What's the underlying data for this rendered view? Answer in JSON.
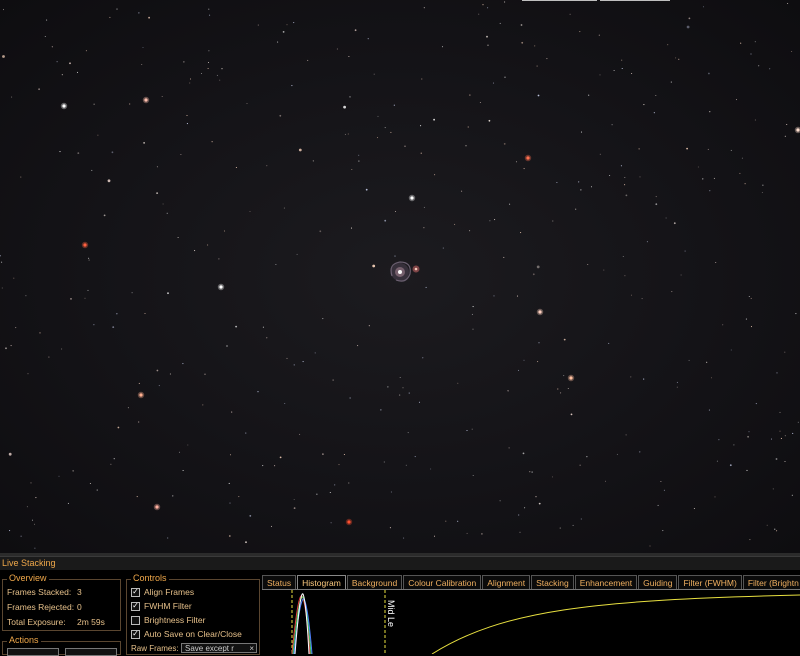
{
  "panel": {
    "title": "Live Stacking",
    "overview": {
      "title": "Overview",
      "frames_stacked_label": "Frames Stacked:",
      "frames_stacked_value": "3",
      "frames_rejected_label": "Frames Rejected:",
      "frames_rejected_value": "0",
      "total_exposure_label": "Total Exposure:",
      "total_exposure_value": "2m 59s"
    },
    "actions": {
      "title": "Actions"
    },
    "controls": {
      "title": "Controls",
      "align_frames": "Align Frames",
      "fwhm_filter": "FWHM Filter",
      "brightness_filter": "Brightness Filter",
      "auto_save": "Auto Save on Clear/Close",
      "raw_frames_label": "Raw Frames:",
      "raw_frames_value": "Save except r",
      "checked_states": [
        true,
        true,
        false,
        true
      ]
    },
    "tabs": [
      "Status",
      "Histogram",
      "Background",
      "Colour Calibration",
      "Alignment",
      "Stacking",
      "Enhancement",
      "Guiding",
      "Filter (FWHM)",
      "Filter (Brightn"
    ],
    "active_tab": "Histogram",
    "histogram": {
      "mid_label": "Mid Le"
    }
  },
  "colors": {
    "accent": "#f0a84a",
    "text": "#e6c08a",
    "sky": "#141317"
  }
}
